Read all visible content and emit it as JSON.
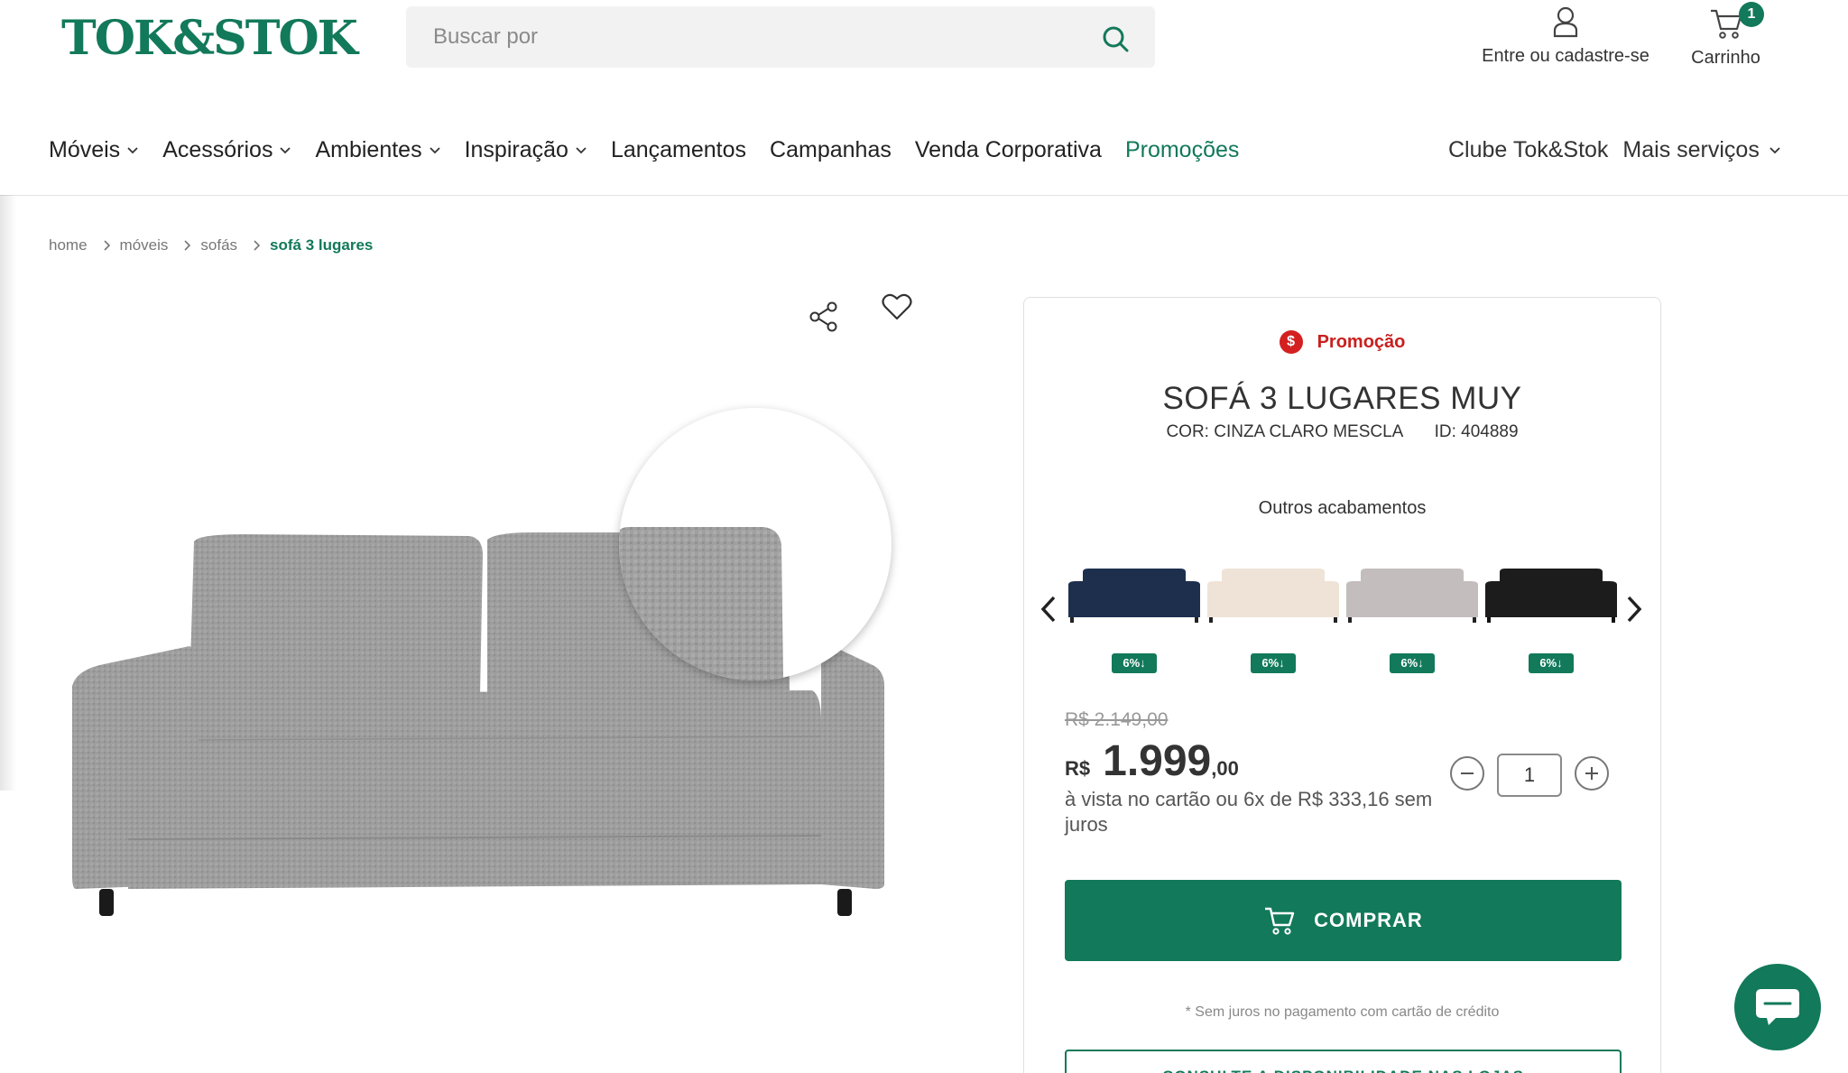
{
  "header": {
    "logo": "TOK&STOK",
    "search_placeholder": "Buscar por",
    "account_label": "Entre ou cadastre-se",
    "cart_label": "Carrinho",
    "cart_count": "1"
  },
  "nav": {
    "items": [
      {
        "label": "Móveis"
      },
      {
        "label": "Acessórios"
      },
      {
        "label": "Ambientes"
      },
      {
        "label": "Inspiração"
      },
      {
        "label": "Lançamentos"
      },
      {
        "label": "Campanhas"
      },
      {
        "label": "Venda Corporativa"
      },
      {
        "label": "Promoções"
      }
    ],
    "clube": "Clube Tok&Stok",
    "mais_servicos": "Mais serviços"
  },
  "breadcrumb": [
    "home",
    "móveis",
    "sofás",
    "sofá 3 lugares"
  ],
  "product": {
    "promo_label": "Promoção",
    "promo_symbol": "$",
    "title": "SOFÁ 3 LUGARES MUY",
    "color": "COR: CINZA CLARO MESCLA",
    "id": "ID: 404889",
    "outros_label": "Outros acabamentos",
    "swatches": [
      {
        "color": "#1e2f4e",
        "discount": "6%↓"
      },
      {
        "color": "#efe3d8",
        "discount": "6%↓"
      },
      {
        "color": "#c4bdbd",
        "discount": "6%↓"
      },
      {
        "color": "#1c1c1c",
        "discount": "6%↓"
      }
    ],
    "old_price": "R$ 2.149,00",
    "currency": "R$",
    "price_int": "1.999",
    "price_cents": ",00",
    "installments": "à vista no cartão ou 6x de R$ 333,16 sem juros",
    "quantity": "1",
    "buy_label": "COMPRAR",
    "note": "* Sem juros no pagamento com cartão de crédito",
    "availability_label": "CONSULTE A DISPONIBILIDADE NAS LOJAS"
  },
  "colors": {
    "brand": "#12795a",
    "promo": "#c8201f"
  }
}
